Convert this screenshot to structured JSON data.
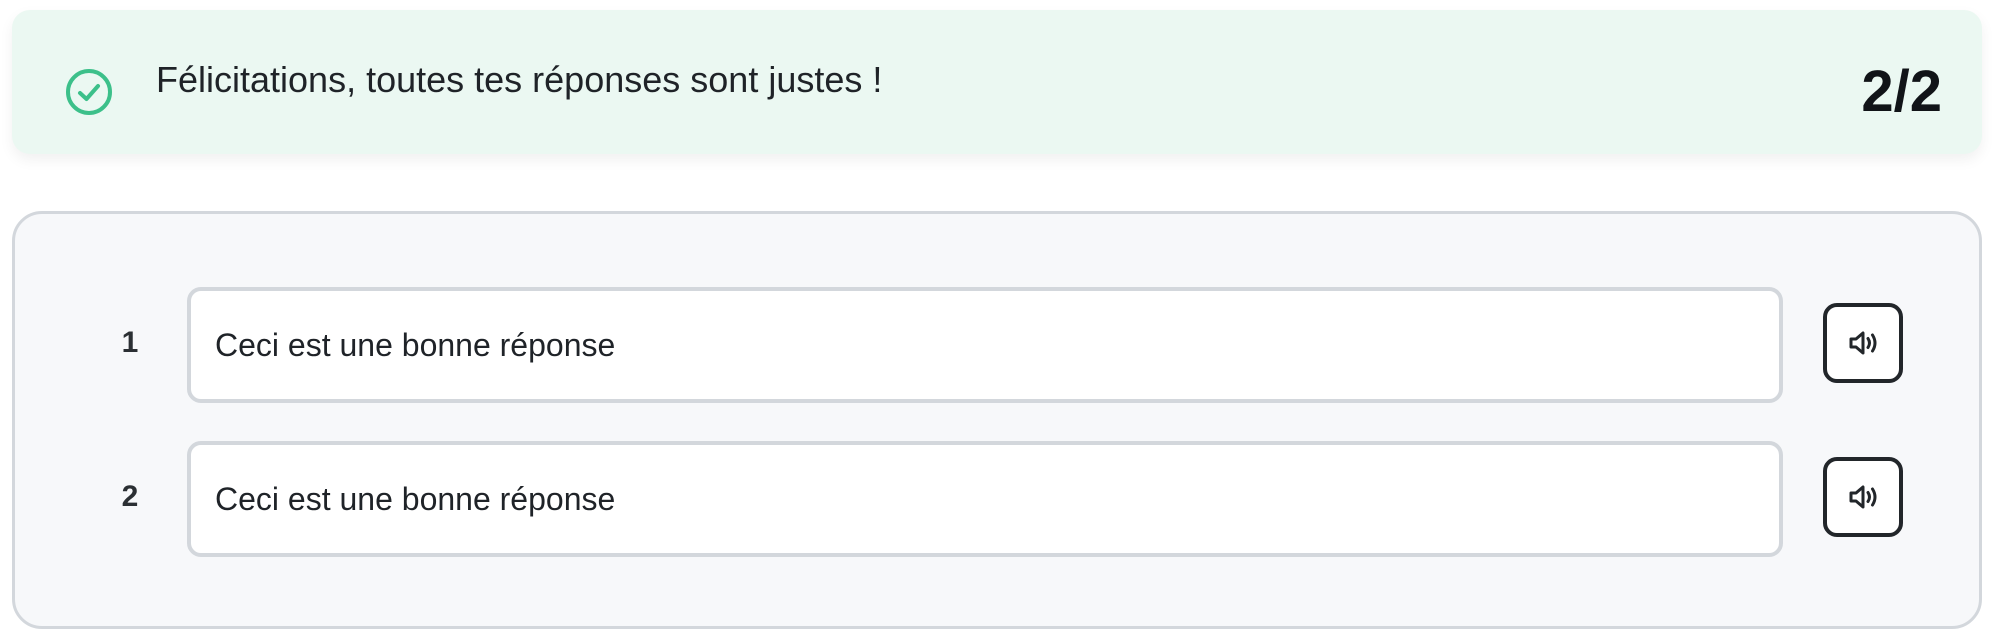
{
  "banner": {
    "icon": "check-circle-icon",
    "message": "Félicitations, toutes tes réponses sont justes !",
    "score": "2/2",
    "background_color": "#ebf8f2",
    "icon_color": "#3cc08a"
  },
  "answers": [
    {
      "number": "1",
      "text": "Ceci est une bonne réponse",
      "audio_icon": "speaker-icon"
    },
    {
      "number": "2",
      "text": "Ceci est une bonne réponse",
      "audio_icon": "speaker-icon"
    }
  ]
}
